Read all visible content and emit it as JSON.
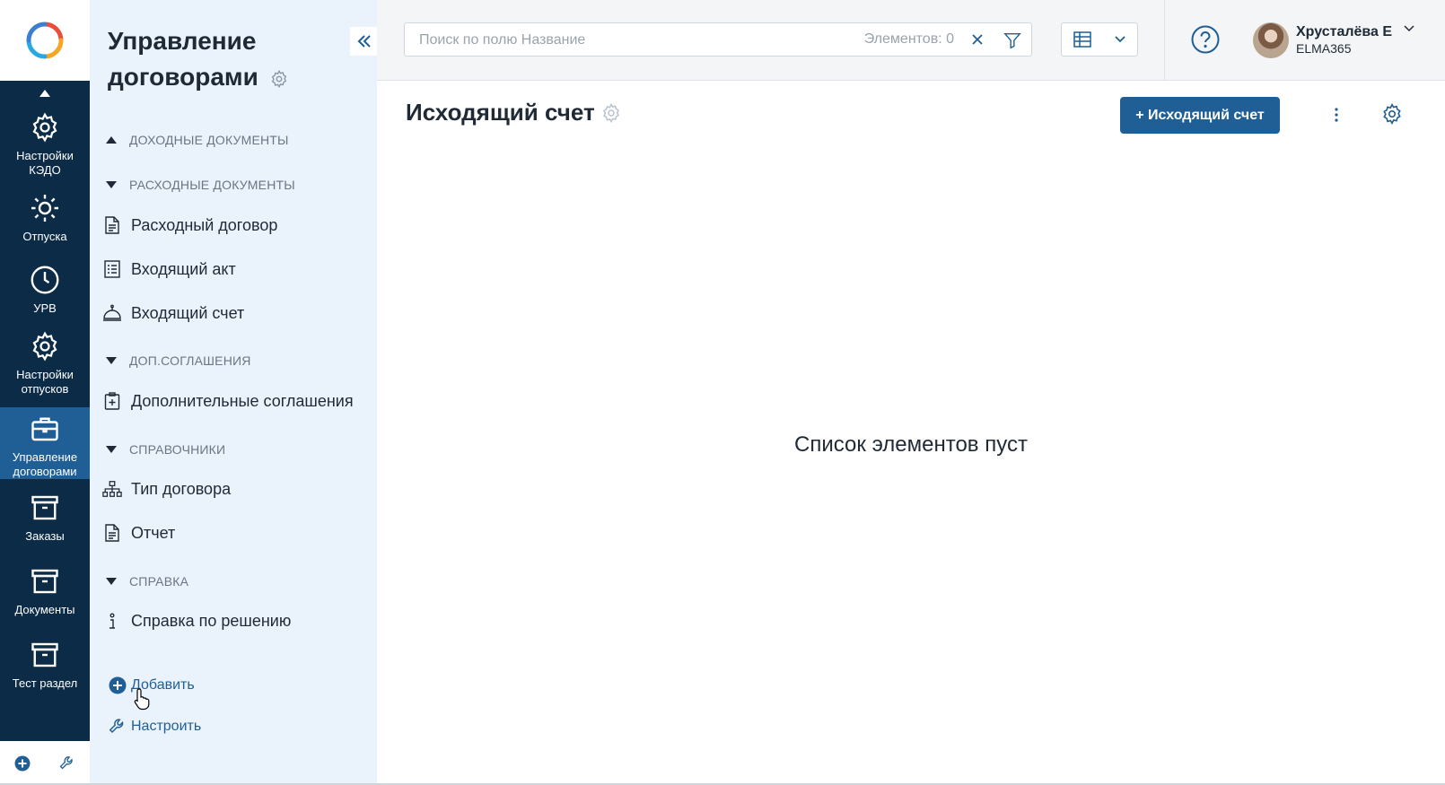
{
  "rail": {
    "items": [
      {
        "label": "Настройки КЭДО",
        "icon": "gear-icon"
      },
      {
        "label": "Отпуска",
        "icon": "sun-icon"
      },
      {
        "label": "УРВ",
        "icon": "clock-icon"
      },
      {
        "label": "Настройки отпусков",
        "icon": "gear-icon"
      },
      {
        "label": "Управление договорами",
        "icon": "briefcase-icon",
        "active": true
      },
      {
        "label": "Заказы",
        "icon": "archive-box-icon"
      },
      {
        "label": "Документы",
        "icon": "archive-box-icon"
      },
      {
        "label": "Тест раздел",
        "icon": "archive-box-icon"
      }
    ]
  },
  "sidebar": {
    "title": "Управление договорами",
    "groups": {
      "income": "ДОХОДНЫЕ ДОКУМЕНТЫ",
      "expense": "РАСХОДНЫЕ ДОКУМЕНТЫ",
      "supplements": "ДОП.СОГЛАШЕНИЯ",
      "references": "СПРАВОЧНИКИ",
      "help": "СПРАВКА"
    },
    "items": {
      "expense_contract": "Расходный договор",
      "incoming_act": "Входящий акт",
      "incoming_invoice": "Входящий счет",
      "supplements": "Дополнительные соглашения",
      "contract_type": "Тип договора",
      "report": "Отчет",
      "solution_help": "Справка по решению"
    },
    "add_label": "Добавить",
    "configure_label": "Настроить"
  },
  "topbar": {
    "search_placeholder": "Поиск по полю Название",
    "elements_count": "Элементов: 0",
    "user": {
      "name": "Хрусталёва Е",
      "org": "ELMA365"
    }
  },
  "main": {
    "title": "Исходящий счет",
    "create_button": "+ Исходящий счет",
    "empty_message": "Список элементов пуст"
  },
  "colors": {
    "rail_bg": "#0b2b46",
    "rail_active": "#1f5f96",
    "sidebar_bg": "#eaf2fb",
    "accent": "#1f5f96"
  }
}
